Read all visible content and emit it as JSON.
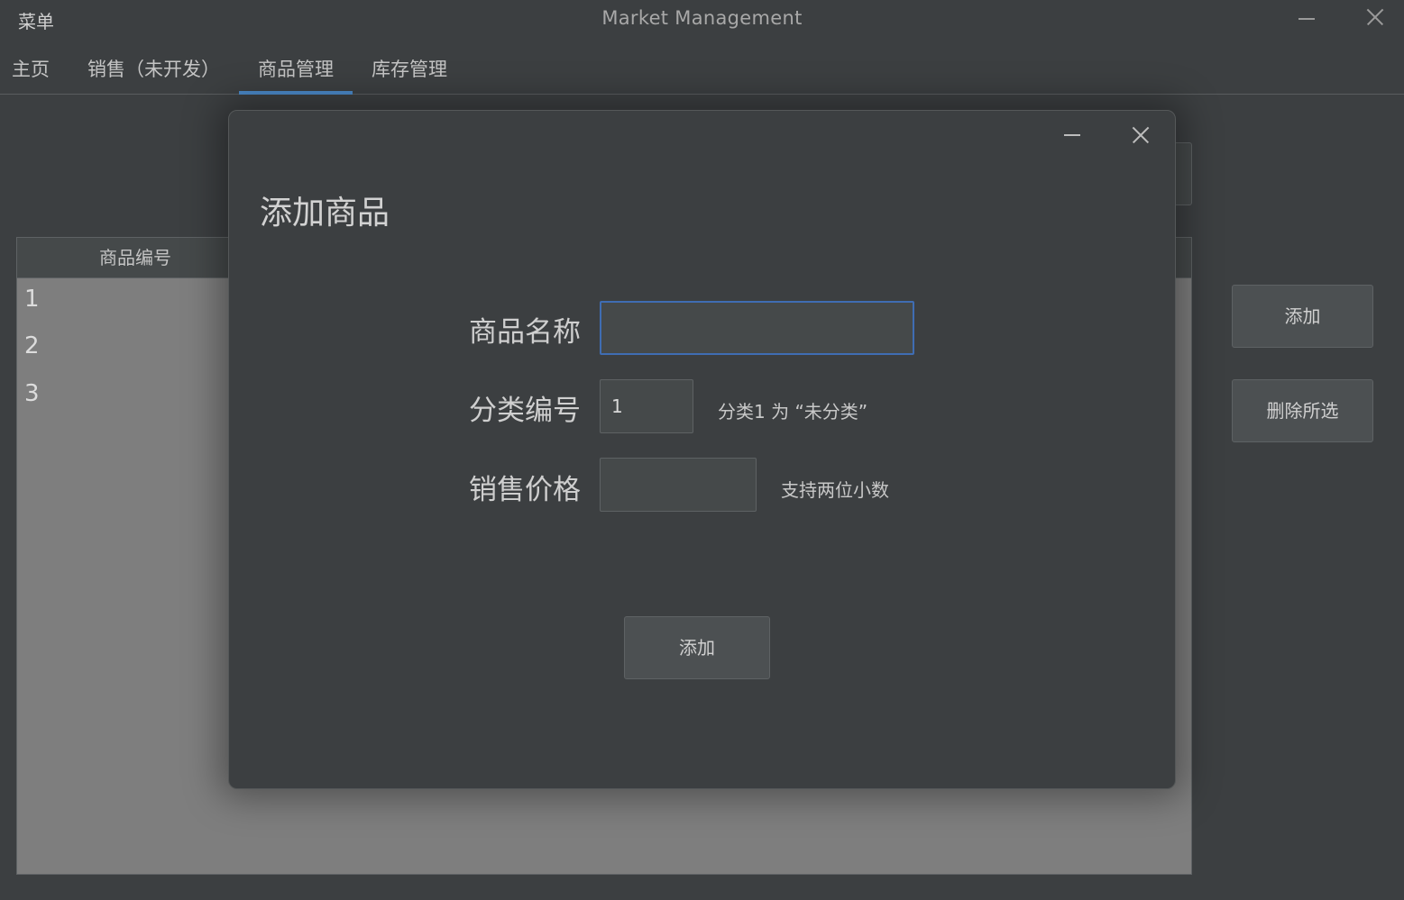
{
  "titlebar": {
    "menu_label": "菜单",
    "window_title": "Market Management"
  },
  "tabs": [
    {
      "label": "主页",
      "active": false
    },
    {
      "label": "销售（未开发）",
      "active": false
    },
    {
      "label": "商品管理",
      "active": true
    },
    {
      "label": "库存管理",
      "active": false
    }
  ],
  "table": {
    "header_id": "商品编号",
    "rows": [
      "1",
      "2",
      "3"
    ]
  },
  "side_buttons": {
    "add_label": "添加",
    "delete_label": "删除所选"
  },
  "modal": {
    "title": "添加商品",
    "fields": {
      "name_label": "商品名称",
      "name_value": "",
      "category_label": "分类编号",
      "category_value": "1",
      "category_hint": "分类1 为 “未分类”",
      "price_label": "销售价格",
      "price_value": "",
      "price_hint": "支持两位小数"
    },
    "add_label": "添加"
  },
  "colors": {
    "background": "#3c3f41",
    "accent": "#4a88c7",
    "focus_border": "#3f6db3",
    "table_body": "#7e7e7e"
  }
}
